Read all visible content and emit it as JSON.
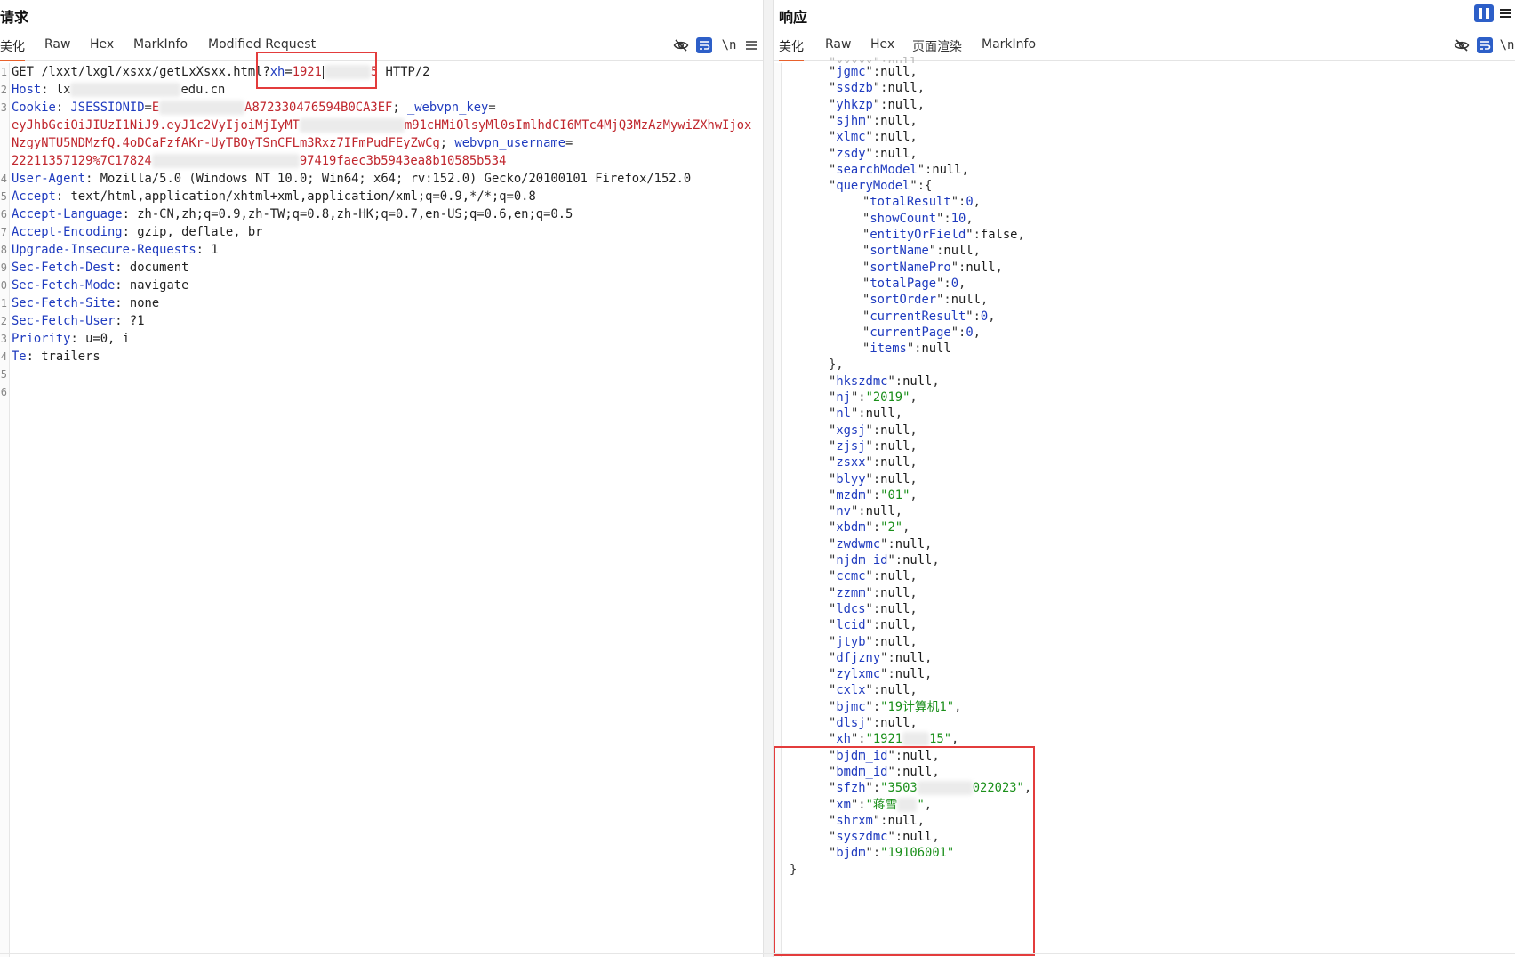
{
  "request": {
    "title": "请求",
    "tabs": [
      "美化",
      "Raw",
      "Hex",
      "MarkInfo",
      "Modified Request"
    ],
    "active_tab": "美化",
    "tools": {
      "hide_icon": "eye-off-icon",
      "wrap_icon": "wrap-icon",
      "newline_label": "\\n",
      "menu_icon": "menu-icon"
    },
    "line_numbers": [
      "1",
      "2",
      "3",
      "",
      "",
      "",
      "4",
      "5",
      "6",
      "7",
      "8",
      "9",
      "0",
      "1",
      "2",
      "3",
      "4",
      "5",
      "6"
    ],
    "line1": {
      "method": "GET",
      "path": "/lxxt/lxgl/xsxx/getLxXsxx.html",
      "query_key": "xh",
      "query_eq": "=",
      "query_q": "?",
      "query_val_a": "192",
      "query_val_b": "5",
      "protocol": "HTTP/2"
    },
    "host": {
      "key": "Host",
      "sep": ":",
      "val_a": "lx",
      "val_b": "edu.cn"
    },
    "cookie": {
      "key": "Cookie",
      "sess_key": "JSESSIONID",
      "sess_val_a": "E",
      "sess_val_b": "A872330476594B0CA3EF",
      "webvpn_key_name": "_webvpn_key",
      "line2_a": "eyJhbGciOiJIUzI1NiJ9.eyJ1c2VyIjoiMjIyMT",
      "line2_b": "m91cHMiOlsyMl0sImlhdCI6MTc4MjQ3MzAzMywiZXhwIjox",
      "line3_a": "NzgyNTU5NDMzfQ.4oDCaFzfAKr-UyTBOyTSnCFLm3Rxz7IFmPudFEyZwCg",
      "webvpn_username_name": "webvpn_username",
      "line4_a": "22211357129%7C17824",
      "line4_b": "97419faec3b5943ea8b10585b534"
    },
    "headers": [
      {
        "k": "User-Agent",
        "v": "Mozilla/5.0 (Windows NT 10.0; Win64; x64; rv:152.0) Gecko/20100101 Firefox/152.0"
      },
      {
        "k": "Accept",
        "v": "text/html,application/xhtml+xml,application/xml;q=0.9,*/*;q=0.8"
      },
      {
        "k": "Accept-Language",
        "v": "zh-CN,zh;q=0.9,zh-TW;q=0.8,zh-HK;q=0.7,en-US;q=0.6,en;q=0.5"
      },
      {
        "k": "Accept-Encoding",
        "v": "gzip, deflate, br"
      },
      {
        "k": "Upgrade-Insecure-Requests",
        "v": "1"
      },
      {
        "k": "Sec-Fetch-Dest",
        "v": "document"
      },
      {
        "k": "Sec-Fetch-Mode",
        "v": "navigate"
      },
      {
        "k": "Sec-Fetch-Site",
        "v": "none"
      },
      {
        "k": "Sec-Fetch-User",
        "v": "?1"
      },
      {
        "k": "Priority",
        "v": "u=0, i"
      },
      {
        "k": "Te",
        "v": "trailers"
      }
    ]
  },
  "response": {
    "title": "响应",
    "tabs": [
      "美化",
      "Raw",
      "Hex",
      "页面渲染",
      "MarkInfo"
    ],
    "active_tab": "美化",
    "tools": {
      "hide_icon": "eye-off-icon",
      "wrap_icon": "wrap-icon",
      "newline_label": "\\n",
      "layout_icon": "split-layout-icon",
      "menu_icon": "menu-icon"
    },
    "top_fields": [
      {
        "k": "jgmc",
        "v": "null",
        "t": "n"
      },
      {
        "k": "ssdzb",
        "v": "null",
        "t": "n"
      },
      {
        "k": "yhkzp",
        "v": "null",
        "t": "n"
      },
      {
        "k": "sjhm",
        "v": "null",
        "t": "n"
      },
      {
        "k": "xlmc",
        "v": "null",
        "t": "n"
      },
      {
        "k": "zsdy",
        "v": "null",
        "t": "n"
      },
      {
        "k": "searchModel",
        "v": "null",
        "t": "n"
      }
    ],
    "query_model_key": "queryModel",
    "query_model": [
      {
        "k": "totalResult",
        "v": "0",
        "t": "n"
      },
      {
        "k": "showCount",
        "v": "10",
        "t": "n"
      },
      {
        "k": "entityOrField",
        "v": "false",
        "t": "n"
      },
      {
        "k": "sortName",
        "v": "null",
        "t": "n"
      },
      {
        "k": "sortNamePro",
        "v": "null",
        "t": "n"
      },
      {
        "k": "totalPage",
        "v": "0",
        "t": "n"
      },
      {
        "k": "sortOrder",
        "v": "null",
        "t": "n"
      },
      {
        "k": "currentResult",
        "v": "0",
        "t": "n"
      },
      {
        "k": "currentPage",
        "v": "0",
        "t": "n"
      },
      {
        "k": "items",
        "v": "null",
        "t": "n",
        "last": true
      }
    ],
    "after_fields": [
      {
        "k": "hkszdmc",
        "v": "null",
        "t": "n"
      },
      {
        "k": "nj",
        "v": "\"2019\"",
        "t": "s"
      },
      {
        "k": "nl",
        "v": "null",
        "t": "n"
      },
      {
        "k": "xgsj",
        "v": "null",
        "t": "n"
      },
      {
        "k": "zjsj",
        "v": "null",
        "t": "n"
      },
      {
        "k": "zsxx",
        "v": "null",
        "t": "n"
      },
      {
        "k": "blyy",
        "v": "null",
        "t": "n"
      },
      {
        "k": "mzdm",
        "v": "\"01\"",
        "t": "s"
      },
      {
        "k": "nv",
        "v": "null",
        "t": "n"
      },
      {
        "k": "xbdm",
        "v": "\"2\"",
        "t": "s"
      },
      {
        "k": "zwdwmc",
        "v": "null",
        "t": "n"
      },
      {
        "k": "njdm_id",
        "v": "null",
        "t": "n"
      },
      {
        "k": "ccmc",
        "v": "null",
        "t": "n"
      },
      {
        "k": "zzmm",
        "v": "null",
        "t": "n"
      },
      {
        "k": "ldcs",
        "v": "null",
        "t": "n"
      },
      {
        "k": "lcid",
        "v": "null",
        "t": "n"
      },
      {
        "k": "jtyb",
        "v": "null",
        "t": "n"
      },
      {
        "k": "dfjzny",
        "v": "null",
        "t": "n"
      },
      {
        "k": "zylxmc",
        "v": "null",
        "t": "n"
      },
      {
        "k": "cxlx",
        "v": "null",
        "t": "n"
      },
      {
        "k": "bjmc",
        "v": "\"19计算机1\"",
        "t": "s"
      },
      {
        "k": "dlsj",
        "v": "null",
        "t": "n"
      },
      {
        "k": "xh",
        "v_a": "\"1921",
        "v_b": "15\"",
        "t": "sb"
      },
      {
        "k": "bjdm_id",
        "v": "null",
        "t": "n"
      },
      {
        "k": "bmdm_id",
        "v": "null",
        "t": "n"
      },
      {
        "k": "sfzh",
        "v_a": "\"3503",
        "v_b": "022023\"",
        "t": "sb"
      },
      {
        "k": "xm",
        "v_a": "\"蒋雪",
        "v_b": "\"",
        "t": "sb"
      },
      {
        "k": "shrxm",
        "v": "null",
        "t": "n"
      },
      {
        "k": "syszdmc",
        "v": "null",
        "t": "n"
      },
      {
        "k": "bjdm",
        "v": "\"19106001\"",
        "t": "s",
        "last": true
      }
    ],
    "closing_brace": "}",
    "query_close": "},",
    "query_open": ":{"
  },
  "colors": {
    "accent": "#e8612c",
    "key": "#1f3bbf",
    "string": "#1a8f1a",
    "cookie_value": "#c0262d",
    "highlight": "#e33c3c"
  }
}
